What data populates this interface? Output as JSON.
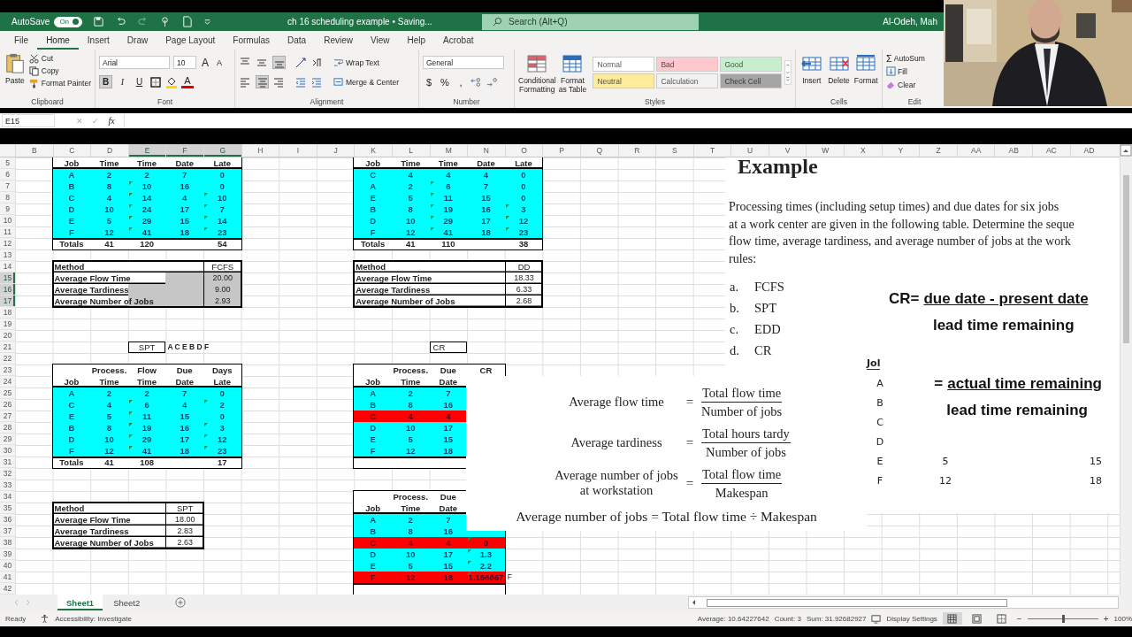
{
  "title_bar": {
    "autosave_label": "AutoSave",
    "autosave": {
      "on": true,
      "label": "On"
    },
    "document_title": "ch 16 scheduling example • Saving...",
    "search_placeholder": "Search (Alt+Q)",
    "user": "Al-Odeh, Mah"
  },
  "menu_tabs": [
    {
      "label": "File",
      "selected": false
    },
    {
      "label": "Home",
      "selected": true
    },
    {
      "label": "Insert",
      "selected": false
    },
    {
      "label": "Draw",
      "selected": false
    },
    {
      "label": "Page Layout",
      "selected": false
    },
    {
      "label": "Formulas",
      "selected": false
    },
    {
      "label": "Data",
      "selected": false
    },
    {
      "label": "Review",
      "selected": false
    },
    {
      "label": "View",
      "selected": false
    },
    {
      "label": "Help",
      "selected": false
    },
    {
      "label": "Acrobat",
      "selected": false
    }
  ],
  "ribbon": {
    "clipboard": {
      "paste": "Paste",
      "cut": "Cut",
      "copy": "Copy",
      "format_painter": "Format Painter",
      "label": "Clipboard"
    },
    "font": {
      "family": "Arial",
      "size": "10",
      "grow": "A",
      "shrink": "A",
      "bold": {
        "glyph": "B",
        "selected": true
      },
      "italic": {
        "glyph": "I",
        "selected": false
      },
      "underline": {
        "glyph": "U",
        "selected": false
      },
      "font_color": "A",
      "label": "Font"
    },
    "alignment": {
      "vertical": [
        {
          "kind": "top",
          "selected": false
        },
        {
          "kind": "middle",
          "selected": false
        },
        {
          "kind": "bottom",
          "selected": true
        }
      ],
      "horizontal": [
        {
          "kind": "left",
          "selected": false
        },
        {
          "kind": "center",
          "selected": true
        },
        {
          "kind": "right",
          "selected": false
        }
      ],
      "wrap_text": "Wrap Text",
      "merge": "Merge & Center",
      "label": "Alignment"
    },
    "number": {
      "format": "General",
      "currency": "$",
      "percent": "%",
      "comma": ",",
      "label": "Number"
    },
    "styles": {
      "conditional": "Conditional Formatting",
      "format_table": "Format as Table",
      "label": "Styles",
      "gallery": [
        {
          "label": "Normal",
          "color": "#ffffff"
        },
        {
          "label": "Bad",
          "color": "#ffc7ce"
        },
        {
          "label": "Good",
          "color": "#c6efce"
        },
        {
          "label": "Neutral",
          "color": "#ffeb9c"
        },
        {
          "label": "Calculation",
          "color": "#f2f2f2"
        },
        {
          "label": "Check Cell",
          "color": "#a5a5a5"
        }
      ]
    },
    "cells": {
      "buttons": [
        {
          "kind": "insert",
          "label": "Insert"
        },
        {
          "kind": "delete",
          "label": "Delete"
        },
        {
          "kind": "format",
          "label": "Format"
        }
      ],
      "label": "Cells"
    },
    "editing": {
      "autosum_glyph": "Σ",
      "autosum": "AutoSum",
      "fill": "Fill",
      "clear": "Clear",
      "label": "Edit"
    }
  },
  "formula_bar": {
    "name_box": "E15",
    "cancel": "✕",
    "enter": "✓",
    "function": "fx"
  },
  "sheet": {
    "columns": [
      {
        "label": "B",
        "selected": false
      },
      {
        "label": "C",
        "selected": false
      },
      {
        "label": "D",
        "selected": false
      },
      {
        "label": "E",
        "selected": true
      },
      {
        "label": "F",
        "selected": true
      },
      {
        "label": "G",
        "selected": true
      },
      {
        "label": "H",
        "selected": false
      },
      {
        "label": "I",
        "selected": false
      },
      {
        "label": "J",
        "selected": false
      },
      {
        "label": "K",
        "selected": false
      },
      {
        "label": "L",
        "selected": false
      },
      {
        "label": "M",
        "selected": false
      },
      {
        "label": "N",
        "selected": false
      },
      {
        "label": "O",
        "selected": false
      },
      {
        "label": "P",
        "selected": false
      },
      {
        "label": "Q",
        "selected": false
      },
      {
        "label": "R",
        "selected": false
      },
      {
        "label": "S",
        "selected": false
      },
      {
        "label": "T",
        "selected": false
      },
      {
        "label": "U",
        "selected": false
      },
      {
        "label": "V",
        "selected": false
      },
      {
        "label": "W",
        "selected": false
      },
      {
        "label": "X",
        "selected": false
      },
      {
        "label": "Y",
        "selected": false
      },
      {
        "label": "Z",
        "selected": false
      },
      {
        "label": "AA",
        "selected": false
      },
      {
        "label": "AB",
        "selected": false
      },
      {
        "label": "AC",
        "selected": false
      },
      {
        "label": "AD",
        "selected": false
      }
    ],
    "rows": [
      {
        "label": "5",
        "selected": false
      },
      {
        "label": "6",
        "selected": false
      },
      {
        "label": "7",
        "selected": false
      },
      {
        "label": "8",
        "selected": false
      },
      {
        "label": "9",
        "selected": false
      },
      {
        "label": "10",
        "selected": false
      },
      {
        "label": "11",
        "selected": false
      },
      {
        "label": "12",
        "selected": false
      },
      {
        "label": "13",
        "selected": false
      },
      {
        "label": "14",
        "selected": false
      },
      {
        "label": "15",
        "selected": true
      },
      {
        "label": "16",
        "selected": true
      },
      {
        "label": "17",
        "selected": true
      },
      {
        "label": "18",
        "selected": false
      },
      {
        "label": "19",
        "selected": false
      },
      {
        "label": "20",
        "selected": false
      },
      {
        "label": "21",
        "selected": false
      },
      {
        "label": "22",
        "selected": false
      },
      {
        "label": "23",
        "selected": false
      },
      {
        "label": "24",
        "selected": false
      },
      {
        "label": "25",
        "selected": false
      },
      {
        "label": "26",
        "selected": false
      },
      {
        "label": "27",
        "selected": false
      },
      {
        "label": "28",
        "selected": false
      },
      {
        "label": "29",
        "selected": false
      },
      {
        "label": "30",
        "selected": false
      },
      {
        "label": "31",
        "selected": false
      },
      {
        "label": "32",
        "selected": false
      },
      {
        "label": "33",
        "selected": false
      },
      {
        "label": "34",
        "selected": false
      },
      {
        "label": "35",
        "selected": false
      },
      {
        "label": "36",
        "selected": false
      },
      {
        "label": "37",
        "selected": false
      },
      {
        "label": "38",
        "selected": false
      },
      {
        "label": "39",
        "selected": false
      },
      {
        "label": "40",
        "selected": false
      },
      {
        "label": "41",
        "selected": false
      },
      {
        "label": "42",
        "selected": false
      }
    ],
    "left": [
      {
        "kind": "table",
        "rows": [
          {
            "kind": "header",
            "cells": [
              "Job",
              "Time",
              "Time",
              "Date",
              "Late"
            ]
          },
          {
            "kind": "data",
            "color": "#00ffff",
            "cells": [
              "A",
              "2",
              "2",
              "7",
              "0"
            ]
          },
          {
            "kind": "data",
            "color": "#00ffff",
            "cells": [
              "B",
              "8",
              {
                "t": "10",
                "flag": true
              },
              "16",
              "0"
            ]
          },
          {
            "kind": "data",
            "color": "#00ffff",
            "cells": [
              "C",
              "4",
              {
                "t": "14",
                "flag": true
              },
              "4",
              {
                "t": "10",
                "flag": true
              }
            ]
          },
          {
            "kind": "data",
            "color": "#00ffff",
            "cells": [
              "D",
              "10",
              {
                "t": "24",
                "flag": true
              },
              "17",
              {
                "t": "7",
                "flag": true
              }
            ]
          },
          {
            "kind": "data",
            "color": "#00ffff",
            "cells": [
              "E",
              "5",
              {
                "t": "29",
                "flag": true
              },
              "15",
              {
                "t": "14",
                "flag": true
              }
            ]
          },
          {
            "kind": "data",
            "color": "#00ffff",
            "cells": [
              "F",
              "12",
              {
                "t": "41",
                "flag": true
              },
              "18",
              {
                "t": "23",
                "flag": true
              }
            ]
          },
          {
            "kind": "total",
            "cells": [
              "Totals",
              "41",
              "120",
              null,
              "54"
            ]
          }
        ]
      },
      {
        "kind": "summary",
        "rows": [
          {
            "label": "Method",
            "value": "FCFS"
          },
          {
            "label": "Average Flow Time",
            "value": "20.00"
          },
          {
            "label": "Average Tardiness",
            "value": "9.00"
          },
          {
            "label": "Average Number of Jobs",
            "value": "2.93"
          }
        ]
      },
      {
        "kind": "caption",
        "box": "SPT",
        "text": "A C E B D F"
      },
      {
        "kind": "table",
        "rows": [
          {
            "kind": "header_top",
            "cells": [
              null,
              "Process.",
              "Flow",
              "Due",
              "Days"
            ]
          },
          {
            "kind": "header",
            "cells": [
              "Job",
              "Time",
              "Time",
              "Date",
              "Late"
            ]
          },
          {
            "kind": "data",
            "color": "#00ffff",
            "cells": [
              "A",
              "2",
              "2",
              "7",
              "0"
            ]
          },
          {
            "kind": "data",
            "color": "#00ffff",
            "cells": [
              "C",
              "4",
              {
                "t": "6",
                "flag": true
              },
              "4",
              {
                "t": "2",
                "flag": true
              }
            ]
          },
          {
            "kind": "data",
            "color": "#00ffff",
            "cells": [
              "E",
              "5",
              {
                "t": "11",
                "flag": true
              },
              "15",
              "0"
            ]
          },
          {
            "kind": "data",
            "color": "#00ffff",
            "cells": [
              "B",
              "8",
              {
                "t": "19",
                "flag": true
              },
              "16",
              {
                "t": "3",
                "flag": true
              }
            ]
          },
          {
            "kind": "data",
            "color": "#00ffff",
            "cells": [
              "D",
              "10",
              {
                "t": "29",
                "flag": true
              },
              "17",
              {
                "t": "12",
                "flag": true
              }
            ]
          },
          {
            "kind": "data",
            "color": "#00ffff",
            "cells": [
              "F",
              "12",
              {
                "t": "41",
                "flag": true
              },
              "18",
              {
                "t": "23",
                "flag": true
              }
            ]
          },
          {
            "kind": "total",
            "cells": [
              "Totals",
              "41",
              "108",
              null,
              "17"
            ]
          }
        ]
      },
      {
        "kind": "summary",
        "rows": [
          {
            "label": "Method",
            "value": "SPT"
          },
          {
            "label": "Average Flow Time",
            "value": "18.00"
          },
          {
            "label": "Average Tardiness",
            "value": "2.83"
          },
          {
            "label": "Average Number of Jobs",
            "value": "2.63"
          }
        ]
      }
    ],
    "right": [
      {
        "kind": "table",
        "rows": [
          {
            "kind": "header",
            "cells": [
              "Job",
              "Time",
              "Time",
              "Date",
              "Late"
            ]
          },
          {
            "kind": "data",
            "color": "#00ffff",
            "cells": [
              "C",
              "4",
              "4",
              "4",
              "0"
            ]
          },
          {
            "kind": "data",
            "color": "#00ffff",
            "cells": [
              "A",
              "2",
              {
                "t": "6",
                "flag": true
              },
              "7",
              "0"
            ]
          },
          {
            "kind": "data",
            "color": "#00ffff",
            "cells": [
              "E",
              "5",
              {
                "t": "11",
                "flag": true
              },
              "15",
              "0"
            ]
          },
          {
            "kind": "data",
            "color": "#00ffff",
            "cells": [
              "B",
              "8",
              {
                "t": "19",
                "flag": true
              },
              "16",
              {
                "t": "3",
                "flag": true
              }
            ]
          },
          {
            "kind": "data",
            "color": "#00ffff",
            "cells": [
              "D",
              "10",
              {
                "t": "29",
                "flag": true
              },
              "17",
              {
                "t": "12",
                "flag": true
              }
            ]
          },
          {
            "kind": "data",
            "color": "#00ffff",
            "cells": [
              "F",
              "12",
              {
                "t": "41",
                "flag": true
              },
              "18",
              {
                "t": "23",
                "flag": true
              }
            ]
          },
          {
            "kind": "total",
            "cells": [
              "Totals",
              "41",
              "110",
              null,
              "38"
            ]
          }
        ]
      },
      {
        "kind": "summary",
        "rows": [
          {
            "label": "Method",
            "value": "DD"
          },
          {
            "label": "Average Flow Time",
            "value": "18.33"
          },
          {
            "label": "Average Tardiness",
            "value": "6.33"
          },
          {
            "label": "Average Number of Jobs",
            "value": "2.68"
          }
        ]
      },
      {
        "kind": "caption",
        "box": "CR"
      },
      {
        "kind": "table",
        "rows": [
          {
            "kind": "header_top",
            "cells": [
              null,
              "Process.",
              "Due",
              "CR"
            ]
          },
          {
            "kind": "header",
            "cells": [
              "Job",
              "Time",
              "Date",
              null
            ]
          },
          {
            "kind": "data",
            "color": "#00ffff",
            "cells": [
              "A",
              "2",
              "7",
              null
            ]
          },
          {
            "kind": "data",
            "color": "#00ffff",
            "cells": [
              "B",
              "8",
              "16",
              null
            ]
          },
          {
            "kind": "data",
            "color": "#ff0000",
            "cells": [
              "C",
              "4",
              "4",
              null
            ]
          },
          {
            "kind": "data",
            "color": "#00ffff",
            "cells": [
              "D",
              "10",
              "17",
              null
            ]
          },
          {
            "kind": "data",
            "color": "#00ffff",
            "cells": [
              "E",
              "5",
              "15",
              null
            ]
          },
          {
            "kind": "data",
            "color": "#00ffff",
            "cells": [
              "F",
              "12",
              "18",
              null
            ]
          },
          {
            "kind": "total",
            "cells": [
              null,
              null,
              null,
              null
            ]
          }
        ]
      },
      {
        "kind": "table",
        "rows": [
          {
            "kind": "header_top",
            "cells": [
              null,
              "Process.",
              "Due",
              null
            ]
          },
          {
            "kind": "header",
            "cells": [
              "Job",
              "Time",
              "Date",
              null
            ]
          },
          {
            "kind": "data",
            "color": "#00ffff",
            "cells": [
              "A",
              "2",
              "7",
              null
            ]
          },
          {
            "kind": "data",
            "color": "#00ffff",
            "cells": [
              "B",
              "8",
              "16",
              null
            ]
          },
          {
            "kind": "data",
            "color": "#ff0000",
            "cells": [
              "C",
              "4",
              "4",
              {
                "t": "0",
                "flag": true
              }
            ]
          },
          {
            "kind": "data",
            "color": "#00ffff",
            "cells": [
              "D",
              "10",
              "17",
              {
                "t": "1.3",
                "flag": true
              }
            ]
          },
          {
            "kind": "data",
            "color": "#00ffff",
            "cells": [
              "E",
              "5",
              "15",
              {
                "t": "2.2",
                "flag": true
              }
            ]
          },
          {
            "kind": "data",
            "color": "#ff0000",
            "cells": [
              "F",
              "12",
              "18",
              {
                "t": "1.166667",
                "flag": true
              }
            ],
            "note": "F"
          },
          {
            "kind": "total",
            "cells": [
              null,
              null,
              null,
              null
            ]
          }
        ]
      }
    ]
  },
  "problem_snippet": {
    "heading": "Example",
    "paragraph_lines": [
      "Processing times (including setup times) and due dates for six jobs",
      "at a work center are given in the following table. Determine the seque",
      "flow time, average tardiness, and average number of jobs at the work",
      "rules:"
    ],
    "options": [
      {
        "marker": "a.",
        "text": "FCFS"
      },
      {
        "marker": "b.",
        "text": "SPT"
      },
      {
        "marker": "c.",
        "text": "EDD"
      },
      {
        "marker": "d.",
        "text": "CR"
      }
    ],
    "cr_formula": {
      "prefix": "CR=",
      "numerator": "due date - present date",
      "denominator": "lead time remaining"
    },
    "alt_formula": {
      "prefix": "=",
      "numerator": "actual time remaining",
      "denominator": "lead time remaining"
    },
    "job_table": {
      "header": "Jol",
      "rows": [
        {
          "job": "A"
        },
        {
          "job": "B"
        },
        {
          "job": "C"
        },
        {
          "job": "D"
        },
        {
          "job": "E",
          "time": "5",
          "due": "15"
        },
        {
          "job": "F",
          "time": "12",
          "due": "18"
        }
      ]
    }
  },
  "formula_snippet": {
    "rows": [
      {
        "label": "Average flow time",
        "equals": "=",
        "numerator": "Total flow time",
        "denominator": "Number of jobs"
      },
      {
        "label": "Average tardiness",
        "equals": "=",
        "numerator": "Total hours tardy",
        "denominator": "Number of jobs"
      },
      {
        "label": "Average number of jobs at workstation",
        "equals": "=",
        "numerator": "Total flow time",
        "denominator": "Makespan"
      }
    ],
    "summary_line": "Average number of jobs = Total flow time ÷ Makespan"
  },
  "sheet_tabs": [
    {
      "label": "Sheet1",
      "selected": true
    },
    {
      "label": "Sheet2",
      "selected": false
    }
  ],
  "status_bar": {
    "mode": "Ready",
    "accessibility": "Accessibility: Investigate",
    "average": "Average: 10.64227642",
    "count": "Count: 3",
    "sum": "Sum: 31.92682927",
    "display_settings": "Display Settings",
    "views": [
      {
        "kind": "normal",
        "selected": true
      },
      {
        "kind": "page_layout",
        "selected": false
      },
      {
        "kind": "page_break",
        "selected": false
      }
    ],
    "zoom_out": "−",
    "zoom_in": "+",
    "zoom": {
      "level": 0.5
    },
    "zoom_label": "100%"
  }
}
